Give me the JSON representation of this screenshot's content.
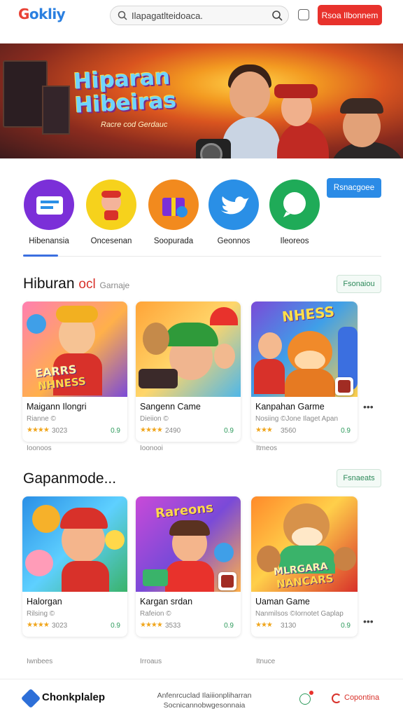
{
  "header": {
    "logo_g": "G",
    "logo_rest": "okliy",
    "search_value": "Ilapagatlteidoaca.",
    "button_label": "Rsoa Ilbonnem"
  },
  "banner": {
    "title_line1": "Hiparan",
    "title_line2": "Hibeiras",
    "subtitle": "Racre cod Gerdauc"
  },
  "categories": {
    "items": [
      {
        "label": "Hibenansia",
        "color": "#7b2fd8",
        "icon": "card-icon"
      },
      {
        "label": "Oncesenan",
        "color": "#f6d21c",
        "icon": "mascot-icon"
      },
      {
        "label": "Soopurada",
        "color": "#f28a1e",
        "icon": "gift-icon"
      },
      {
        "label": "Geonnos",
        "color": "#2a8fe6",
        "icon": "bird-icon"
      },
      {
        "label": "Ileoreos",
        "color": "#1fab58",
        "icon": "chat-icon"
      }
    ],
    "button_label": "Rsnacgoee"
  },
  "section1": {
    "title": "Hiburan",
    "accent": "ocl",
    "muted": "Garnaje",
    "button_label": "Fsonaiou",
    "cards": [
      {
        "name": "Maigann Ilongri",
        "meta": "Rianne ©",
        "stars": "★★★★",
        "count": "3023",
        "price": "0.9",
        "below": "Ioonoos"
      },
      {
        "name": "Sangenn Came",
        "meta": "Dieiion ©",
        "stars": "★★★★",
        "count": "2490",
        "price": "0.9",
        "below": "Ioonooi"
      },
      {
        "name": "Kanpahan Garme",
        "meta": "Nosiing ©Jone Ilaget Apan",
        "stars": "★★★",
        "count": "3560",
        "price": "0.9",
        "below": "Itmeos"
      }
    ]
  },
  "section2": {
    "title": "Gapanmode...",
    "button_label": "Fsnaeats",
    "cards": [
      {
        "name": "Halorgan",
        "meta": "Rilsing ©",
        "stars": "★★★★",
        "count": "3023",
        "price": "0.9",
        "below": "Iwnbees"
      },
      {
        "name": "Kargan srdan",
        "meta": "Rafeion ©",
        "stars": "★★★★",
        "count": "3533",
        "price": "0.9",
        "below": "Irroaus"
      },
      {
        "name": "Uaman Game",
        "meta": "Nanmilsos ©Iornotet Gaplap",
        "stars": "★★★",
        "count": "3130",
        "price": "0.9",
        "below": "Itnuce"
      }
    ]
  },
  "footer": {
    "brand": "Chonkplalep",
    "text": "Anfenrcuclad Ilaiiionpliharran Socnicannobwgesonnaia",
    "link": "Copontina"
  }
}
